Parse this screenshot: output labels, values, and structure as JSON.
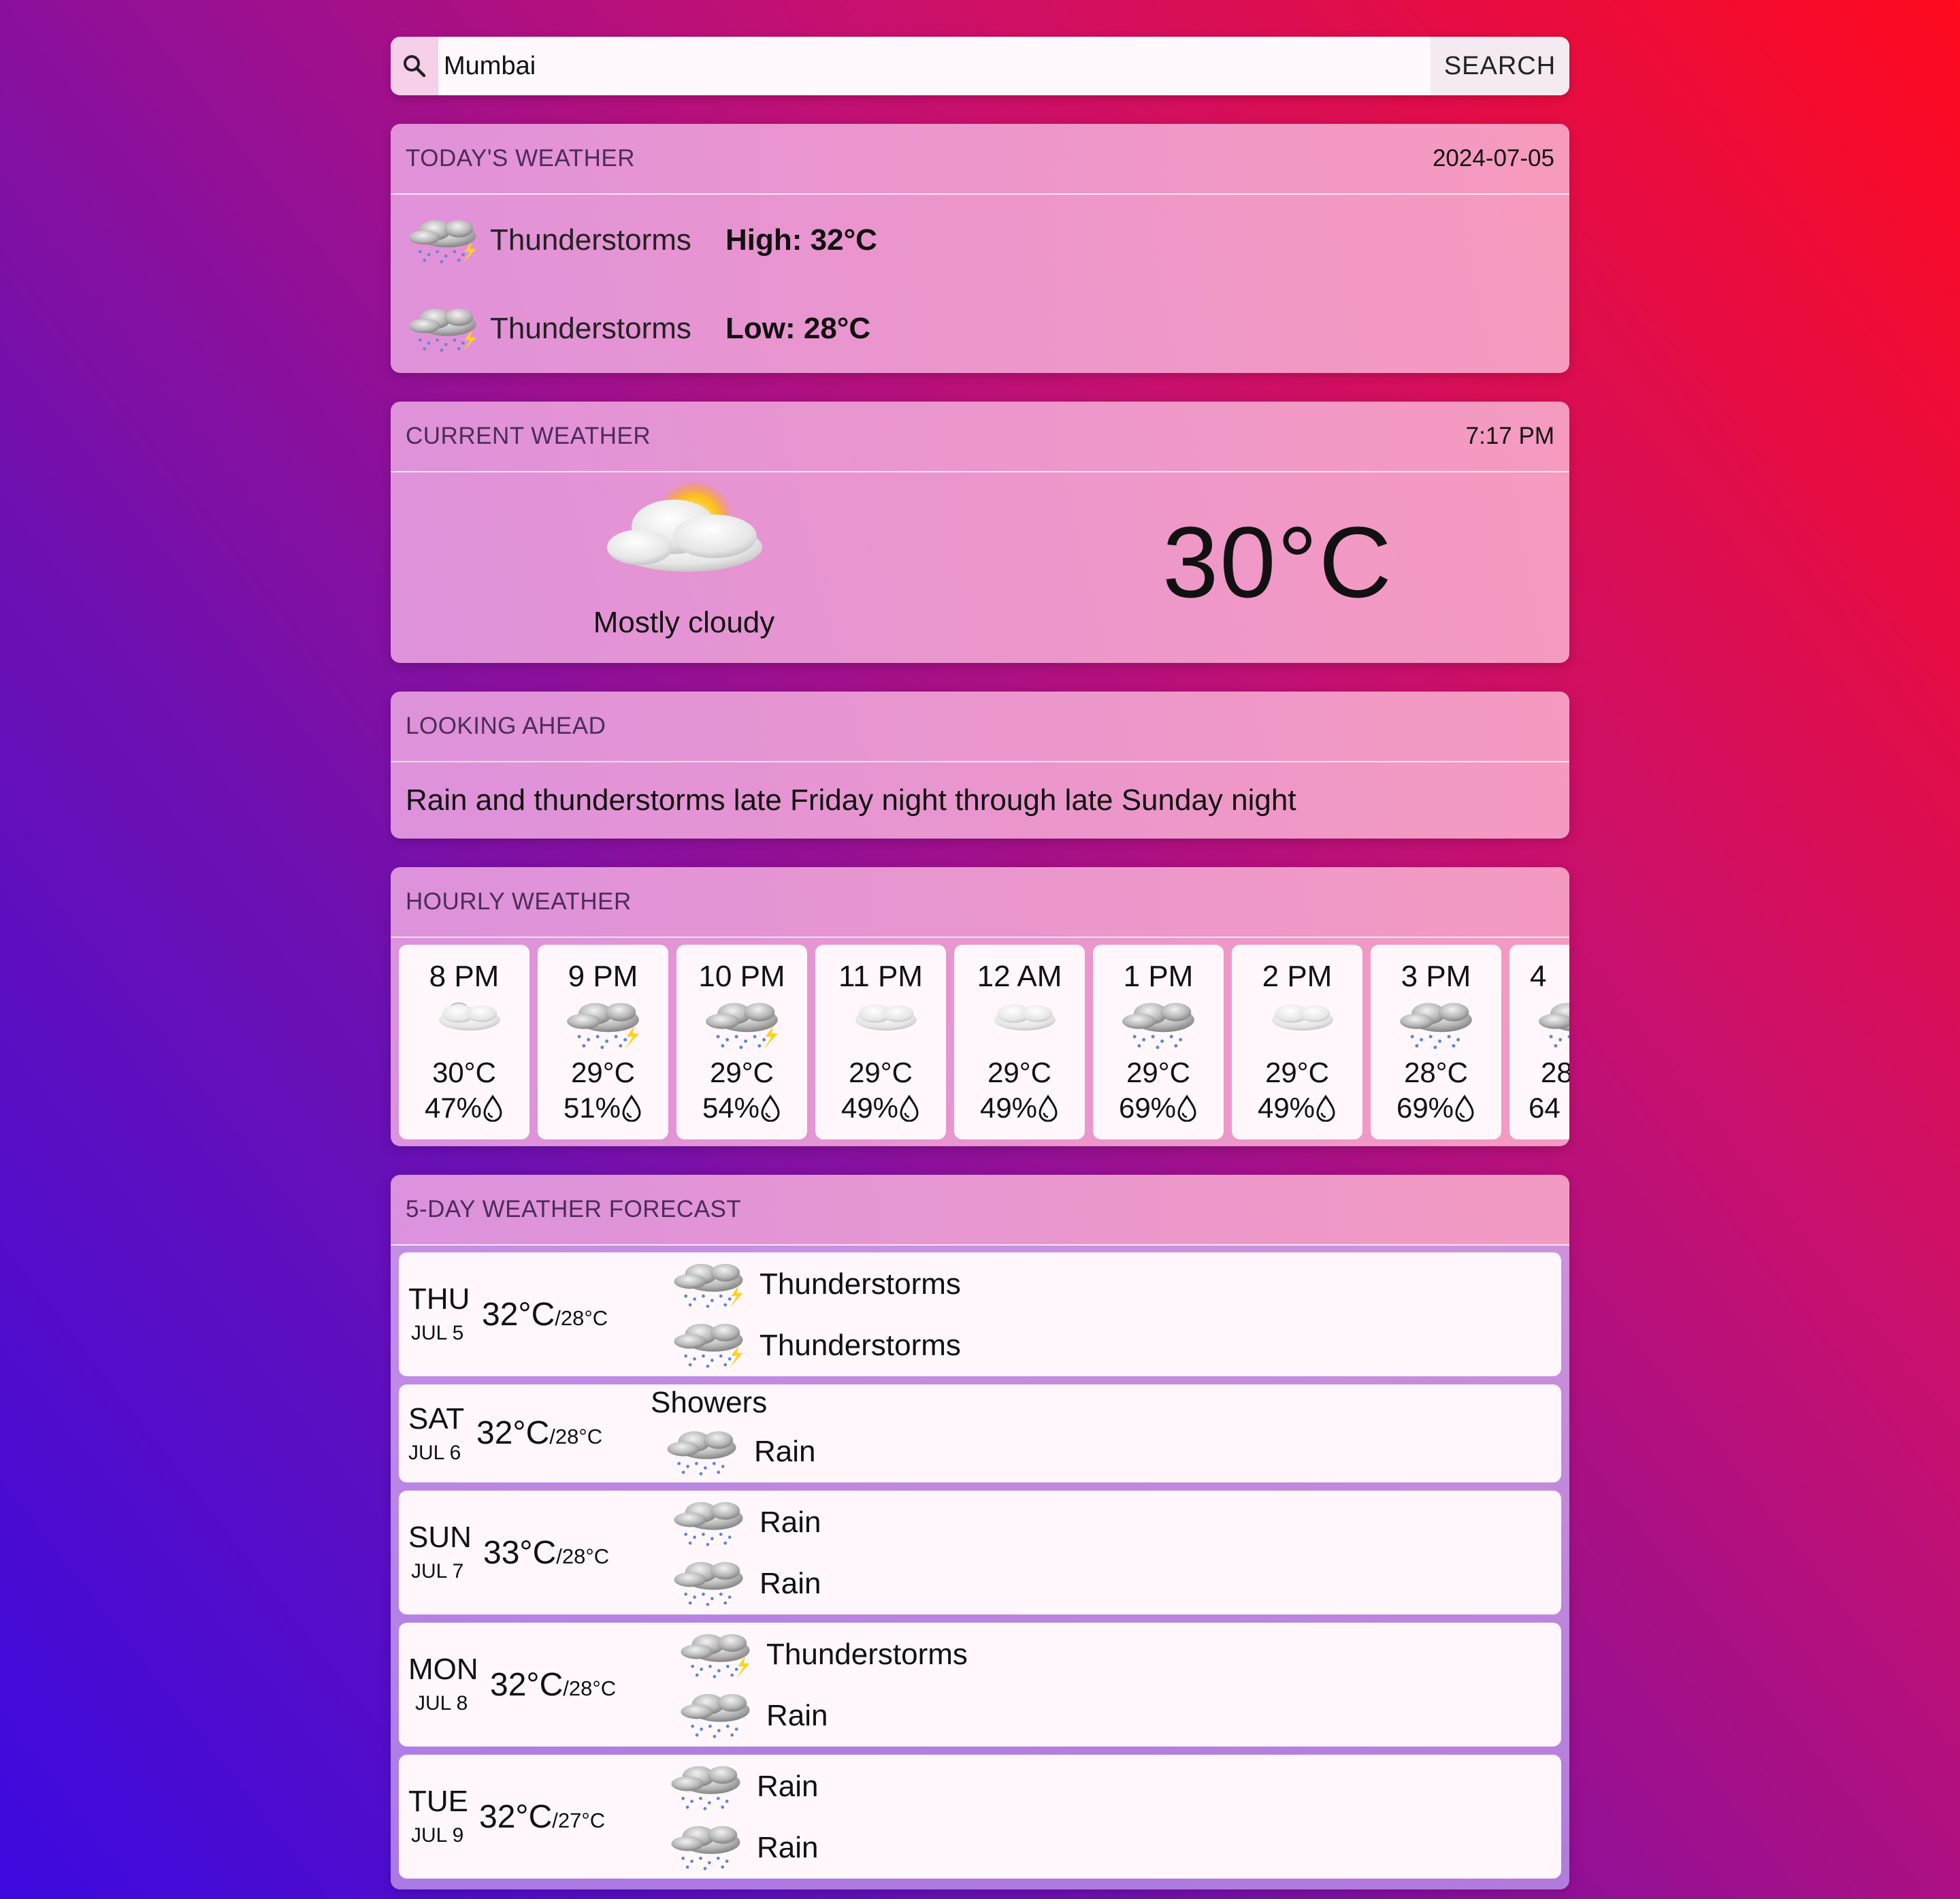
{
  "search": {
    "value": "Mumbai",
    "button_label": "SEARCH",
    "icon": "search-icon"
  },
  "today": {
    "title": "TODAY'S WEATHER",
    "date": "2024-07-05",
    "rows": [
      {
        "condition": "Thunderstorms",
        "label": "High: 32°C",
        "icon": "thunderstorm-icon"
      },
      {
        "condition": "Thunderstorms",
        "label": "Low: 28°C",
        "icon": "thunderstorm-icon"
      }
    ]
  },
  "current": {
    "title": "CURRENT WEATHER",
    "time": "7:17 PM",
    "description": "Mostly cloudy",
    "temperature": "30°C",
    "icon": "mostly-cloudy-icon"
  },
  "ahead": {
    "title": "LOOKING AHEAD",
    "text": "Rain and thunderstorms late Friday night through late Sunday night"
  },
  "hourly": {
    "title": "HOURLY WEATHER",
    "items": [
      {
        "time": "8 PM",
        "temp": "30°C",
        "humidity": "47%",
        "icon": "night-cloudy-icon"
      },
      {
        "time": "9 PM",
        "temp": "29°C",
        "humidity": "51%",
        "icon": "thunderstorm-icon"
      },
      {
        "time": "10 PM",
        "temp": "29°C",
        "humidity": "54%",
        "icon": "thunderstorm-icon"
      },
      {
        "time": "11 PM",
        "temp": "29°C",
        "humidity": "49%",
        "icon": "cloudy-icon"
      },
      {
        "time": "12 AM",
        "temp": "29°C",
        "humidity": "49%",
        "icon": "cloudy-icon"
      },
      {
        "time": "1 PM",
        "temp": "29°C",
        "humidity": "69%",
        "icon": "rain-icon"
      },
      {
        "time": "2 PM",
        "temp": "29°C",
        "humidity": "49%",
        "icon": "cloudy-icon"
      },
      {
        "time": "3 PM",
        "temp": "28°C",
        "humidity": "69%",
        "icon": "rain-icon"
      },
      {
        "time": "4",
        "temp": "28",
        "humidity": "64",
        "icon": "rain-icon"
      }
    ]
  },
  "forecast": {
    "title": "5-DAY WEATHER FORECAST",
    "days": [
      {
        "day": "THU",
        "date": "JUL 5",
        "high": "32°C",
        "low": "/28°C",
        "day_condition": "Thunderstorms",
        "night_condition": "Thunderstorms",
        "day_icon": "thunderstorm-icon",
        "night_icon": "thunderstorm-icon"
      },
      {
        "day": "SAT",
        "date": "JUL 6",
        "high": "32°C",
        "low": "/28°C",
        "day_condition": "Showers",
        "night_condition": "Rain",
        "day_icon": "",
        "night_icon": "rain-icon"
      },
      {
        "day": "SUN",
        "date": "JUL 7",
        "high": "33°C",
        "low": "/28°C",
        "day_condition": "Rain",
        "night_condition": "Rain",
        "day_icon": "rain-icon",
        "night_icon": "rain-icon"
      },
      {
        "day": "MON",
        "date": "JUL 8",
        "high": "32°C",
        "low": "/28°C",
        "day_condition": "Thunderstorms",
        "night_condition": "Rain",
        "day_icon": "thunderstorm-icon",
        "night_icon": "rain-icon"
      },
      {
        "day": "TUE",
        "date": "JUL 9",
        "high": "32°C",
        "low": "/27°C",
        "day_condition": "Rain",
        "night_condition": "Rain",
        "day_icon": "rain-icon",
        "night_icon": "rain-icon"
      }
    ]
  }
}
